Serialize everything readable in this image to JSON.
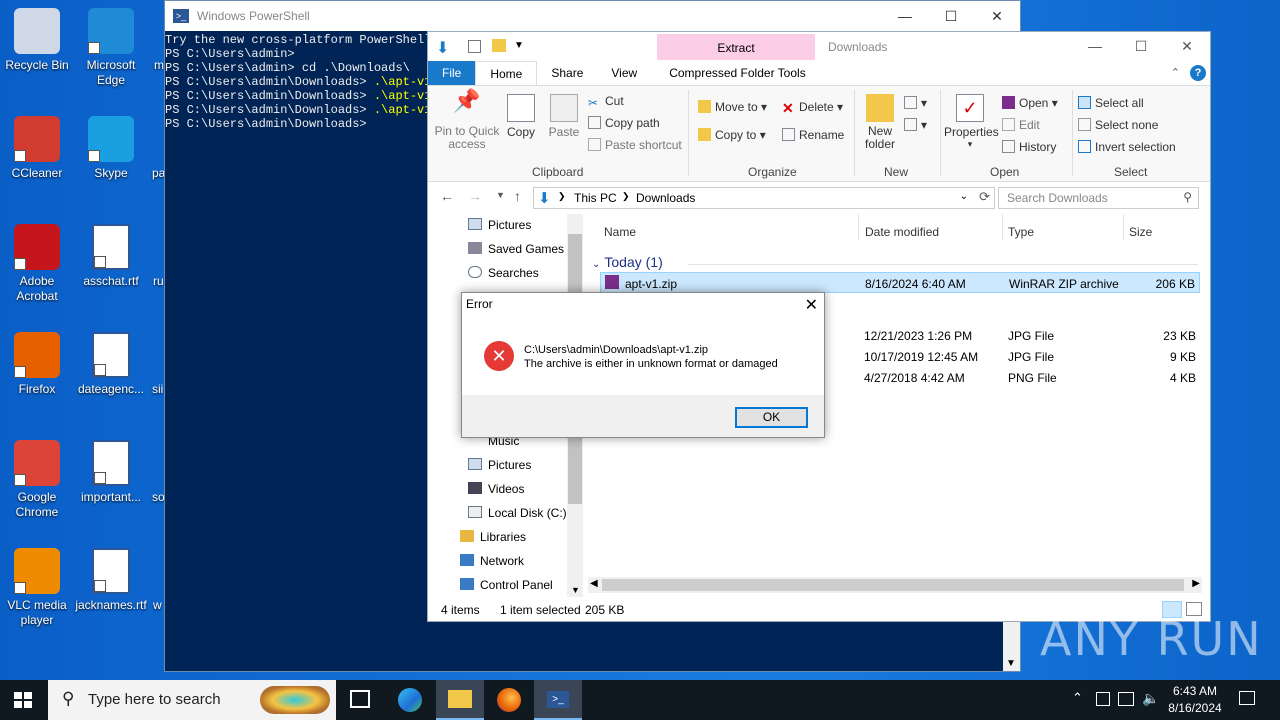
{
  "desktop": {
    "icons": [
      {
        "label": "Recycle Bin",
        "icon": "recycle-bin-icon",
        "color": "#cfd8e6"
      },
      {
        "label": "Microsoft Edge",
        "icon": "edge-icon",
        "color": "#1f8ad6"
      },
      {
        "label": "CCleaner",
        "icon": "ccleaner-icon",
        "color": "#d23b2f"
      },
      {
        "label": "Skype",
        "icon": "skype-icon",
        "color": "#1a9fe0"
      },
      {
        "label": "Adobe Acrobat",
        "icon": "acrobat-icon",
        "color": "#c4161c"
      },
      {
        "label": "asschat.rtf",
        "icon": "word-icon",
        "color": "#2b5797"
      },
      {
        "label": "Firefox",
        "icon": "firefox-icon",
        "color": "#e66000"
      },
      {
        "label": "dateagenc...",
        "icon": "word-icon",
        "color": "#2b5797"
      },
      {
        "label": "Google Chrome",
        "icon": "chrome-icon",
        "color": "#db4437"
      },
      {
        "label": "important...",
        "icon": "word-icon",
        "color": "#2b5797"
      },
      {
        "label": "VLC media player",
        "icon": "vlc-icon",
        "color": "#f08a00"
      },
      {
        "label": "jacknames.rtf",
        "icon": "word-icon",
        "color": "#2b5797"
      }
    ],
    "cut_labels": [
      "m",
      "pa",
      "ru",
      "sii",
      "so",
      "w"
    ]
  },
  "powershell": {
    "title": "Windows PowerShell",
    "lines": [
      "Try the new cross-platform PowerShell",
      "PS C:\\Users\\admin>",
      "PS C:\\Users\\admin> cd .\\Downloads\\",
      "PS C:\\Users\\admin\\Downloads> ",
      ".\\apt-v1.",
      "PS C:\\Users\\admin\\Downloads> ",
      ".\\apt-v1.",
      "PS C:\\Users\\admin\\Downloads> ",
      ".\\apt-v1.",
      "PS C:\\Users\\admin\\Downloads>"
    ]
  },
  "explorer": {
    "context_tab": "Extract",
    "title": "Downloads",
    "tabs": [
      "File",
      "Home",
      "Share",
      "View",
      "Compressed Folder Tools"
    ],
    "ribbon": {
      "pin": "Pin to Quick access",
      "copy": "Copy",
      "paste": "Paste",
      "cut": "Cut",
      "copy_path": "Copy path",
      "paste_shortcut": "Paste shortcut",
      "clipboard": "Clipboard",
      "move_to": "Move to",
      "copy_to": "Copy to",
      "delete": "Delete",
      "rename": "Rename",
      "organize": "Organize",
      "new_folder": "New folder",
      "new": "New",
      "properties": "Properties",
      "open": "Open",
      "edit": "Edit",
      "history": "History",
      "open_grp": "Open",
      "select_all": "Select all",
      "select_none": "Select none",
      "invert": "Invert selection",
      "select": "Select"
    },
    "address": {
      "pc": "This PC",
      "folder": "Downloads",
      "search_placeholder": "Search Downloads"
    },
    "nav": [
      "Pictures",
      "Saved Games",
      "Searches",
      "Music",
      "Pictures",
      "Videos",
      "Local Disk (C:)",
      "Libraries",
      "Network",
      "Control Panel"
    ],
    "columns": [
      "Name",
      "Date modified",
      "Type",
      "Size"
    ],
    "group": "Today (1)",
    "files": [
      {
        "name": "apt-v1.zip",
        "date": "8/16/2024 6:40 AM",
        "type": "WinRAR ZIP archive",
        "size": "206 KB"
      },
      {
        "name": "",
        "date": "12/21/2023 1:26 PM",
        "type": "JPG File",
        "size": "23 KB"
      },
      {
        "name": "",
        "date": "10/17/2019 12:45 AM",
        "type": "JPG File",
        "size": "9 KB"
      },
      {
        "name": "",
        "date": "4/27/2018 4:42 AM",
        "type": "PNG File",
        "size": "4 KB"
      }
    ],
    "status": {
      "items": "4 items",
      "selected": "1 item selected",
      "size": "205 KB"
    }
  },
  "dialog": {
    "title": "Error",
    "path": "C:\\Users\\admin\\Downloads\\apt-v1.zip",
    "message": "The archive is either in unknown format or damaged",
    "ok": "OK"
  },
  "taskbar": {
    "search_placeholder": "Type here to search",
    "time": "6:43 AM",
    "date": "8/16/2024"
  },
  "watermark": "ANY RUN"
}
